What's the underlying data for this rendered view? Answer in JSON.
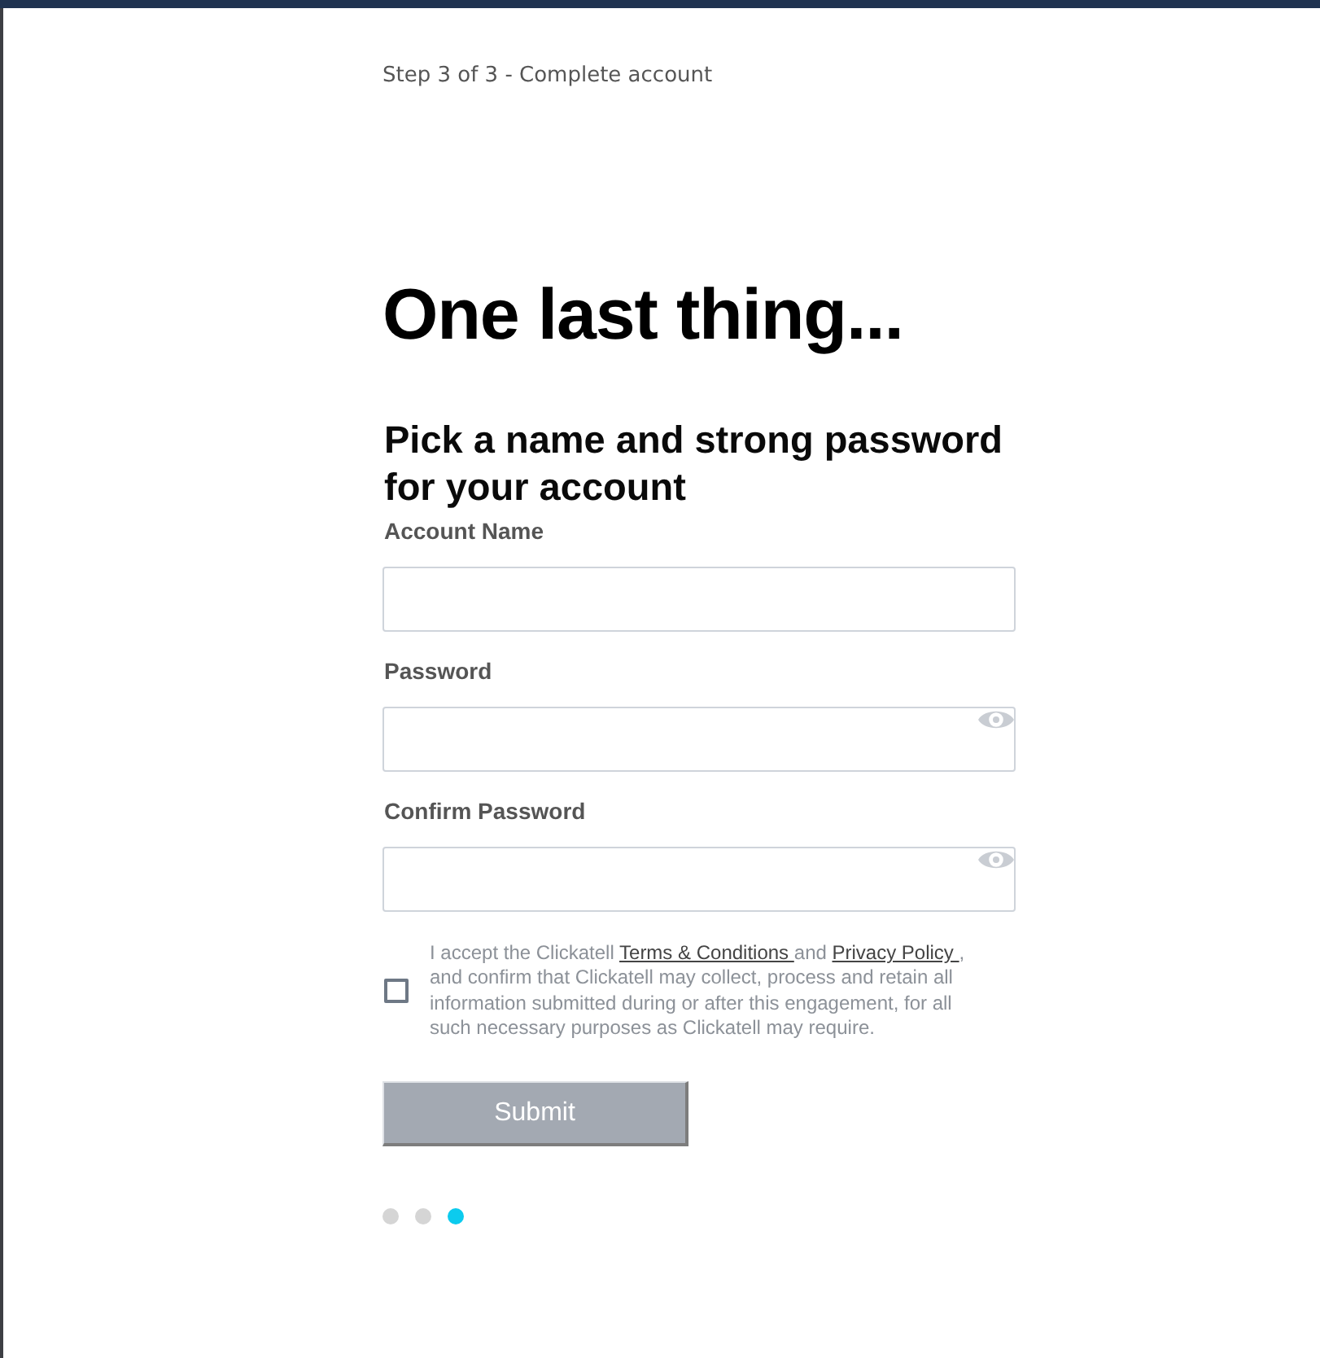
{
  "progress": {
    "label": "Step 3 of 3 - Complete account"
  },
  "heading": "One last thing...",
  "subheading": "Pick a name and strong password for your account",
  "fields": [
    {
      "kind": "text",
      "label": "Account Name"
    },
    {
      "kind": "password",
      "label": "Password"
    },
    {
      "kind": "password",
      "label": "Confirm Password"
    }
  ],
  "consent": {
    "checked": false,
    "parts": [
      {
        "kind": "plain",
        "text": "I accept the Clickatell "
      },
      {
        "kind": "link",
        "text": "Terms & Conditions "
      },
      {
        "kind": "plain",
        "text": "and "
      },
      {
        "kind": "link",
        "text": "Privacy Policy "
      },
      {
        "kind": "plain",
        "text": ", and confirm that Clickatell may collect, process and retain all information submitted during or after this engagement, for all such necessary purposes as Clickatell may require."
      }
    ]
  },
  "submit": {
    "label": "Submit",
    "disabled": true
  },
  "pager": {
    "dots": [
      {
        "selected": false
      },
      {
        "selected": false
      },
      {
        "selected": true
      }
    ]
  }
}
